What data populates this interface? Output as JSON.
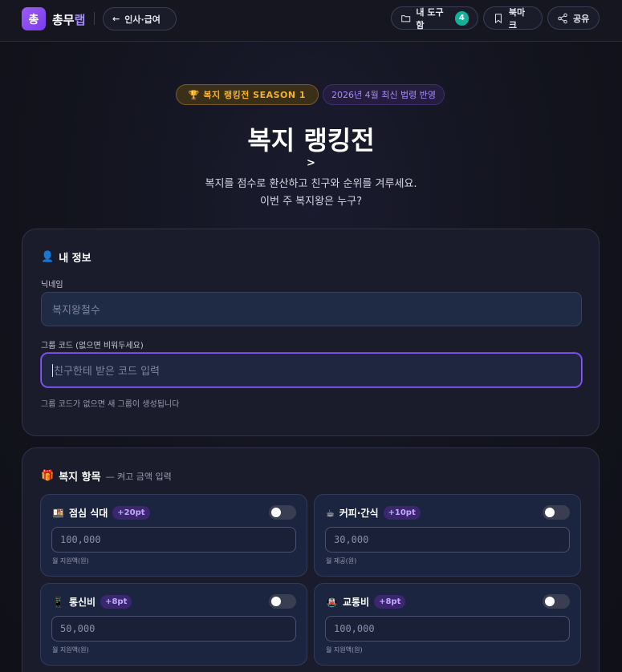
{
  "header": {
    "logo_mark": "총",
    "brand_main": "총무",
    "brand_accent": "랩",
    "back_label": "인사·급여",
    "toolbox_label": "내 도구함",
    "toolbox_count": "4",
    "bookmark_label": "북마크",
    "share_label": "공유"
  },
  "hero": {
    "season_badge": "🏆 복지 랭킹전 SEASON 1",
    "law_badge": "2026년 4월 최신 법령 반영",
    "title": "복지 랭킹전",
    "arrow": ">",
    "subtitle_line1": "복지를 점수로 환산하고 친구와 순위를 겨루세요.",
    "subtitle_line2": "이번 주 복지왕은 누구?"
  },
  "profile": {
    "title": "내 정보",
    "nickname_label": "닉네임",
    "nickname_placeholder": "복지왕철수",
    "group_label": "그룹 코드 (없으면 비워두세요)",
    "group_placeholder": "친구한테 받은 코드 입력",
    "group_helper": "그룹 코드가 없으면 새 그룹이 생성됩니다"
  },
  "welfare": {
    "title": "복지 항목",
    "hint": "— 켜고 금액 입력",
    "items": [
      {
        "emoji": "🍱",
        "name": "점심 식대",
        "points": "+20pt",
        "placeholder": "100,000",
        "sub": "월 지원액(원)",
        "enabled": false
      },
      {
        "emoji": "☕",
        "name": "커피·간식",
        "points": "+10pt",
        "placeholder": "30,000",
        "sub": "월 제공(원)",
        "enabled": false
      },
      {
        "emoji": "📱",
        "name": "통신비",
        "points": "+8pt",
        "placeholder": "50,000",
        "sub": "월 지원액(원)",
        "enabled": false
      },
      {
        "emoji": "🚇",
        "name": "교통비",
        "points": "+8pt",
        "placeholder": "100,000",
        "sub": "월 지원액(원)",
        "enabled": false
      }
    ]
  },
  "colors": {
    "accent": "#8b5cf6",
    "gold": "#f0b232",
    "teal": "#0fb39a"
  }
}
